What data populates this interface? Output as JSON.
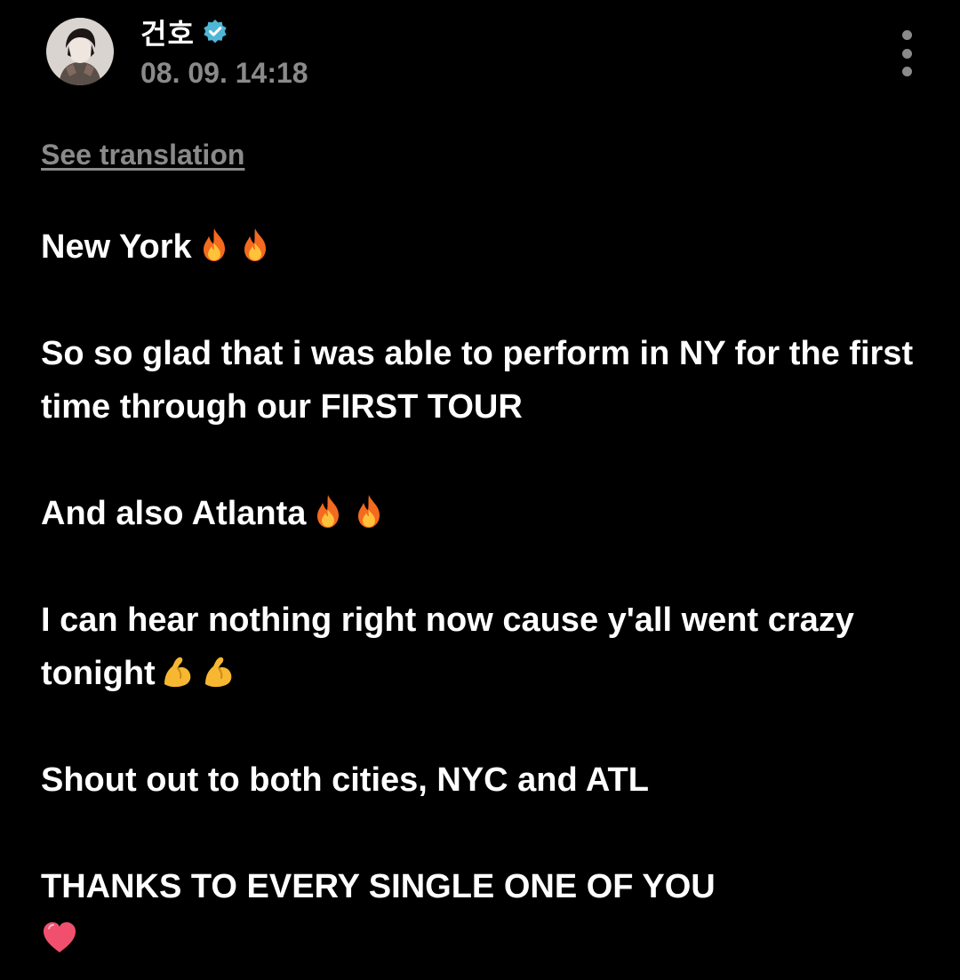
{
  "post": {
    "author": "건호",
    "timestamp": "08. 09. 14:18",
    "translate_label": "See translation",
    "paragraphs": {
      "p1": "New York",
      "p2": "So so glad that i was able to perform in NY for the first time through our FIRST TOUR",
      "p3": "And also Atlanta",
      "p4": "I can hear nothing right now cause y'all went crazy tonight",
      "p5": "Shout out to both cities, NYC and ATL",
      "p6": "THANKS TO EVERY SINGLE ONE OF YOU"
    }
  },
  "icons": {
    "verified": "verified-badge-icon",
    "more": "more-vertical-icon",
    "fire": "fire-emoji",
    "muscle": "flexed-biceps-emoji",
    "heart": "red-heart-emoji"
  },
  "colors": {
    "background": "#000000",
    "text": "#ffffff",
    "muted": "#8a8a8a",
    "verified": "#4fb6d6"
  }
}
